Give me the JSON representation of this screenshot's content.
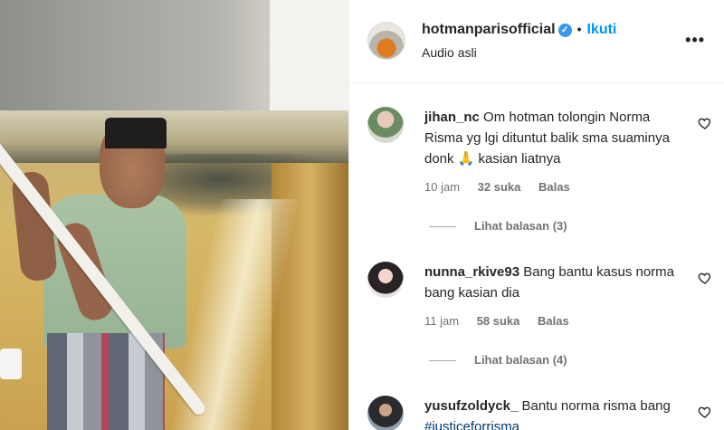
{
  "post": {
    "owner_username": "hotmanparisofficial",
    "follow_label": "Ikuti",
    "audio_label": "Audio asli",
    "more_label": "•••"
  },
  "comments": [
    {
      "username": "jihan_nc",
      "text": "Om hotman tolongin Norma Risma yg lgi dituntut balik sma suaminya donk 🙏 kasian liatnya",
      "time": "10 jam",
      "likes": "32 suka",
      "reply_label": "Balas",
      "view_replies": "Lihat balasan (3)"
    },
    {
      "username": "nunna_rkive93",
      "text": "Bang bantu kasus norma bang kasian dia",
      "time": "11 jam",
      "likes": "58 suka",
      "reply_label": "Balas",
      "view_replies": "Lihat balasan (4)"
    },
    {
      "username": "yusufzoldyck_",
      "text": "Bantu norma risma bang",
      "hashtag": "#justiceforrisma"
    }
  ],
  "icons": {
    "verified": "verified-badge-icon",
    "like": "heart-outline-icon",
    "more": "more-horizontal-icon"
  },
  "colors": {
    "follow_blue": "#0095f6",
    "verified_blue": "#3897f0",
    "meta_gray": "#737373"
  }
}
